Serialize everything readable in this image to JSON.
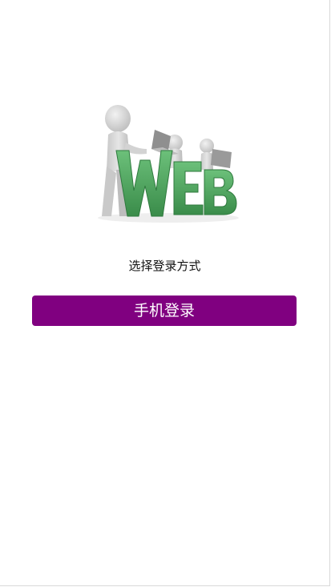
{
  "hero": {
    "logo_text": "WEB",
    "icon": "web-3d-figures-illustration"
  },
  "login": {
    "prompt": "选择登录方式",
    "phone_button_label": "手机登录"
  },
  "colors": {
    "primary_button": "#800080",
    "button_text": "#ffffff",
    "logo_green": "#4aa05a",
    "figure_gray": "#d8d8d8"
  }
}
